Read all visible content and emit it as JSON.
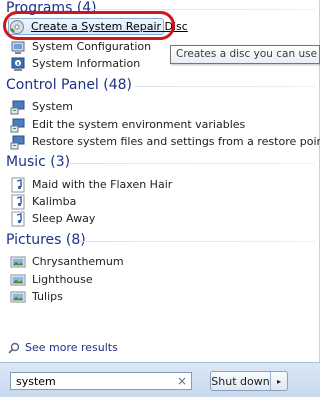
{
  "sections": {
    "programs": {
      "header": "Programs (4)",
      "items": [
        {
          "label": "Create a System Repair Disc",
          "icon": "repair-disc-icon"
        },
        {
          "label": "System Configuration",
          "icon": "system-config-icon"
        },
        {
          "label": "System Information",
          "icon": "system-info-icon"
        }
      ]
    },
    "control_panel": {
      "header": "Control Panel (48)",
      "items": [
        {
          "label": "System",
          "icon": "control-panel-icon"
        },
        {
          "label": "Edit the system environment variables",
          "icon": "control-panel-icon"
        },
        {
          "label": "Restore system files and settings from a restore point",
          "icon": "control-panel-icon"
        }
      ]
    },
    "music": {
      "header": "Music (3)",
      "items": [
        {
          "label": "Maid with the Flaxen Hair",
          "icon": "music-note-icon"
        },
        {
          "label": "Kalimba",
          "icon": "music-note-icon"
        },
        {
          "label": "Sleep Away",
          "icon": "music-note-icon"
        }
      ]
    },
    "pictures": {
      "header": "Pictures (8)",
      "items": [
        {
          "label": "Chrysanthemum",
          "icon": "picture-icon"
        },
        {
          "label": "Lighthouse",
          "icon": "picture-icon"
        },
        {
          "label": "Tulips",
          "icon": "picture-icon"
        }
      ]
    }
  },
  "tooltip": "Creates a disc you can use to acce",
  "see_more": "See more results",
  "search": {
    "value": "system",
    "clear": "×"
  },
  "shutdown": {
    "label": "Shut down",
    "arrow": "▸"
  },
  "colors": {
    "header": "#1e3287",
    "highlight_ring": "#d4141b",
    "selection": "#84acdd"
  }
}
